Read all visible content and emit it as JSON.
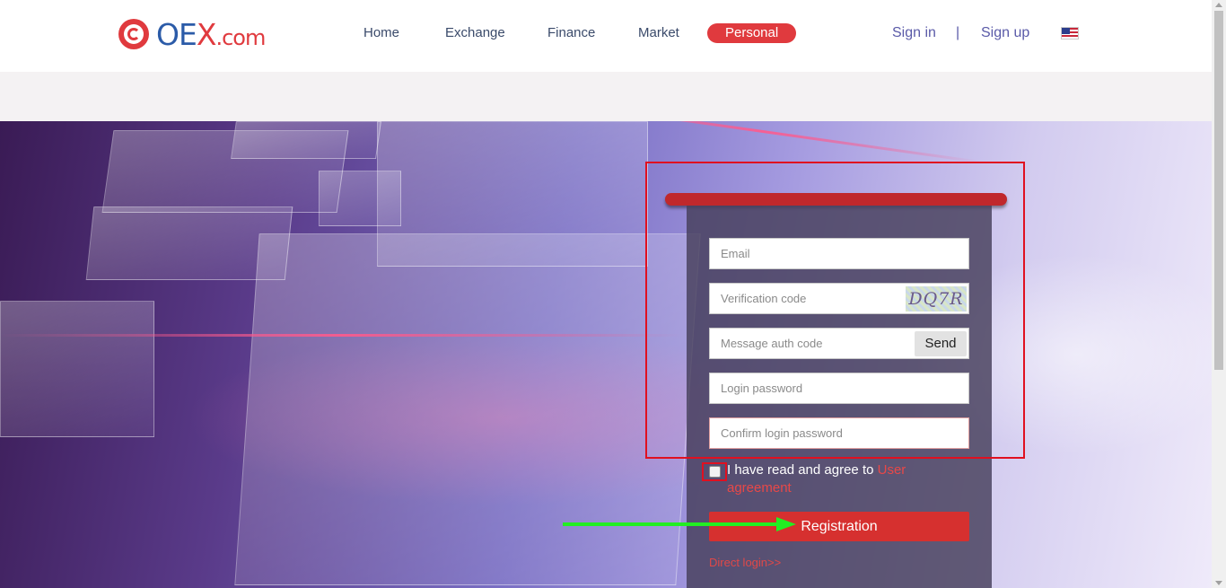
{
  "header": {
    "logo": {
      "brand": "OE",
      "x": "X",
      "domain": ".com"
    },
    "nav": [
      {
        "label": "Home"
      },
      {
        "label": "Exchange"
      },
      {
        "label": "Finance"
      },
      {
        "label": "Market"
      },
      {
        "label": "Personal",
        "active": true
      }
    ],
    "sign_in": "Sign in",
    "separator": "|",
    "sign_up": "Sign up",
    "language_icon": "us-flag-icon"
  },
  "form": {
    "email_placeholder": "Email",
    "verification_placeholder": "Verification code",
    "captcha_text": "DQ7R",
    "message_code_placeholder": "Message auth code",
    "send_label": "Send",
    "login_password_placeholder": "Login password",
    "confirm_password_placeholder": "Confirm login password",
    "agree_text": "I have read and agree to ",
    "agree_link": "User agreement",
    "register_label": "Registration",
    "direct_login": "Direct login>>"
  },
  "colors": {
    "accent": "#d6302f",
    "nav_text": "#3a4a6a",
    "link": "#5a5aa8",
    "annotation": "#e01020",
    "arrow": "#22ee22"
  }
}
